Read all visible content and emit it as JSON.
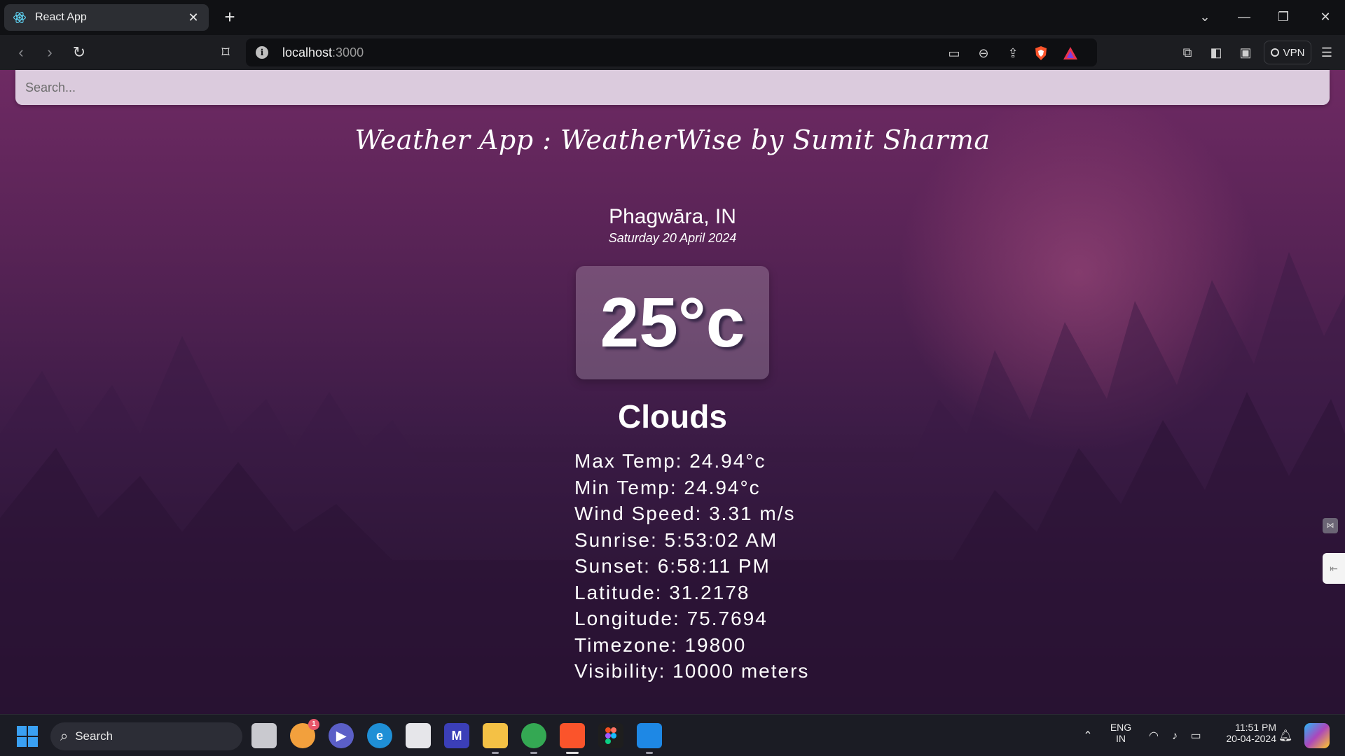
{
  "browser": {
    "tab_title": "React App",
    "url_host": "localhost",
    "url_port": ":3000",
    "vpn_label": "VPN"
  },
  "search": {
    "placeholder": "Search..."
  },
  "app": {
    "title": "Weather App : WeatherWise by Sumit Sharma",
    "location": "Phagwāra, IN",
    "date": "Saturday 20 April 2024",
    "temperature": "25°c",
    "condition": "Clouds",
    "details": [
      "Max Temp: 24.94°c",
      "Min Temp: 24.94°c",
      "Wind Speed: 3.31 m/s",
      "Sunrise: 5:53:02 AM",
      "Sunset: 6:58:11 PM",
      "Latitude: 31.2178",
      "Longitude: 75.7694",
      "Timezone: 19800",
      "Visibility: 10000 meters"
    ]
  },
  "taskbar": {
    "search_label": "Search",
    "language_line1": "ENG",
    "language_line2": "IN",
    "time": "11:51 PM",
    "date": "20-04-2024",
    "badge_count": "1"
  },
  "colors": {
    "accent_blue": "#3aa0f3",
    "brave_orange": "#fb542b"
  }
}
